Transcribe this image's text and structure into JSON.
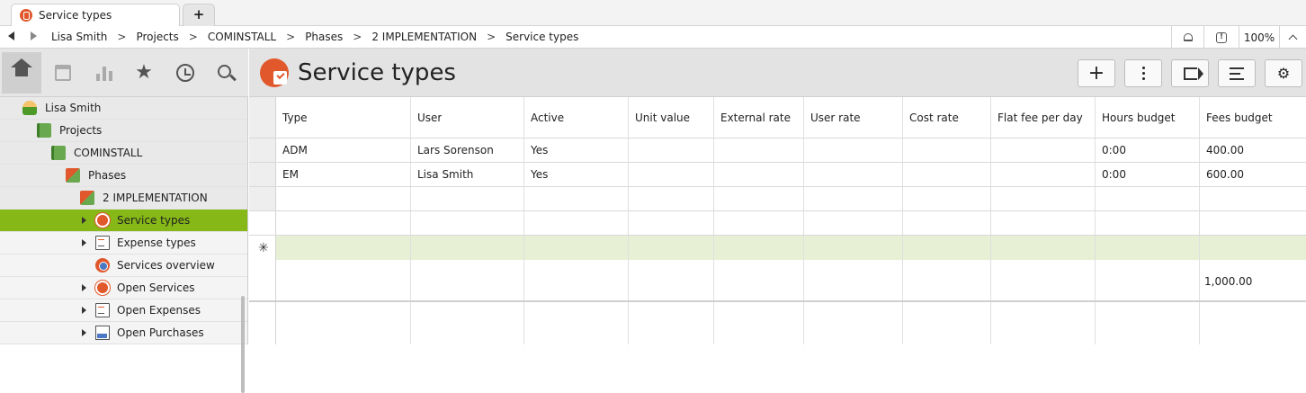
{
  "tab": {
    "title": "Service types",
    "new_tab": "+"
  },
  "breadcrumb": {
    "items": [
      "Lisa Smith",
      "Projects",
      "COMINSTALL",
      "Phases",
      "2 IMPLEMENTATION",
      "Service types"
    ],
    "separator": ">"
  },
  "toolbar": {
    "zoom": "100%"
  },
  "nav_icons": [
    "home-icon",
    "calendar-icon",
    "statistics-icon",
    "star-icon",
    "history-icon",
    "search-icon"
  ],
  "tree": [
    {
      "label": "Lisa Smith",
      "icon": "person-icon",
      "selected": false
    },
    {
      "label": "Projects",
      "icon": "folder-icon",
      "selected": false
    },
    {
      "label": "COMINSTALL",
      "icon": "project-icon",
      "selected": false
    },
    {
      "label": "Phases",
      "icon": "phases-icon",
      "selected": false
    },
    {
      "label": "2 IMPLEMENTATION",
      "icon": "phase-icon",
      "selected": false
    },
    {
      "label": "Service types",
      "icon": "service-types-icon",
      "selected": true
    },
    {
      "label": "Expense types",
      "icon": "expense-types-icon",
      "selected": false
    },
    {
      "label": "Services overview",
      "icon": "services-overview-icon",
      "selected": false
    },
    {
      "label": "Open Services",
      "icon": "open-services-icon",
      "selected": false
    },
    {
      "label": "Open Expenses",
      "icon": "open-expenses-icon",
      "selected": false
    },
    {
      "label": "Open Purchases",
      "icon": "open-purchases-icon",
      "selected": false
    }
  ],
  "page": {
    "title": "Service types"
  },
  "header_buttons": [
    "add-icon",
    "more-icon",
    "forward-icon",
    "list-options-icon",
    "settings-icon"
  ],
  "grid": {
    "columns": [
      "Type",
      "User",
      "Active",
      "Unit value",
      "External rate",
      "User rate",
      "Cost rate",
      "Flat fee per day",
      "Hours budget",
      "Fees budget"
    ],
    "rows": [
      [
        "ADM",
        "Lars Sorenson",
        "Yes",
        "",
        "",
        "",
        "",
        "",
        "0:00",
        "400.00"
      ],
      [
        "EM",
        "Lisa Smith",
        "Yes",
        "",
        "",
        "",
        "",
        "",
        "0:00",
        "600.00"
      ]
    ],
    "new_row_marker": "✳",
    "totals": {
      "fees_budget": "1,000.00"
    }
  },
  "colors": {
    "accent_green": "#86b817",
    "brand_orange": "#e0582b",
    "new_row": "#e7f0d4"
  }
}
